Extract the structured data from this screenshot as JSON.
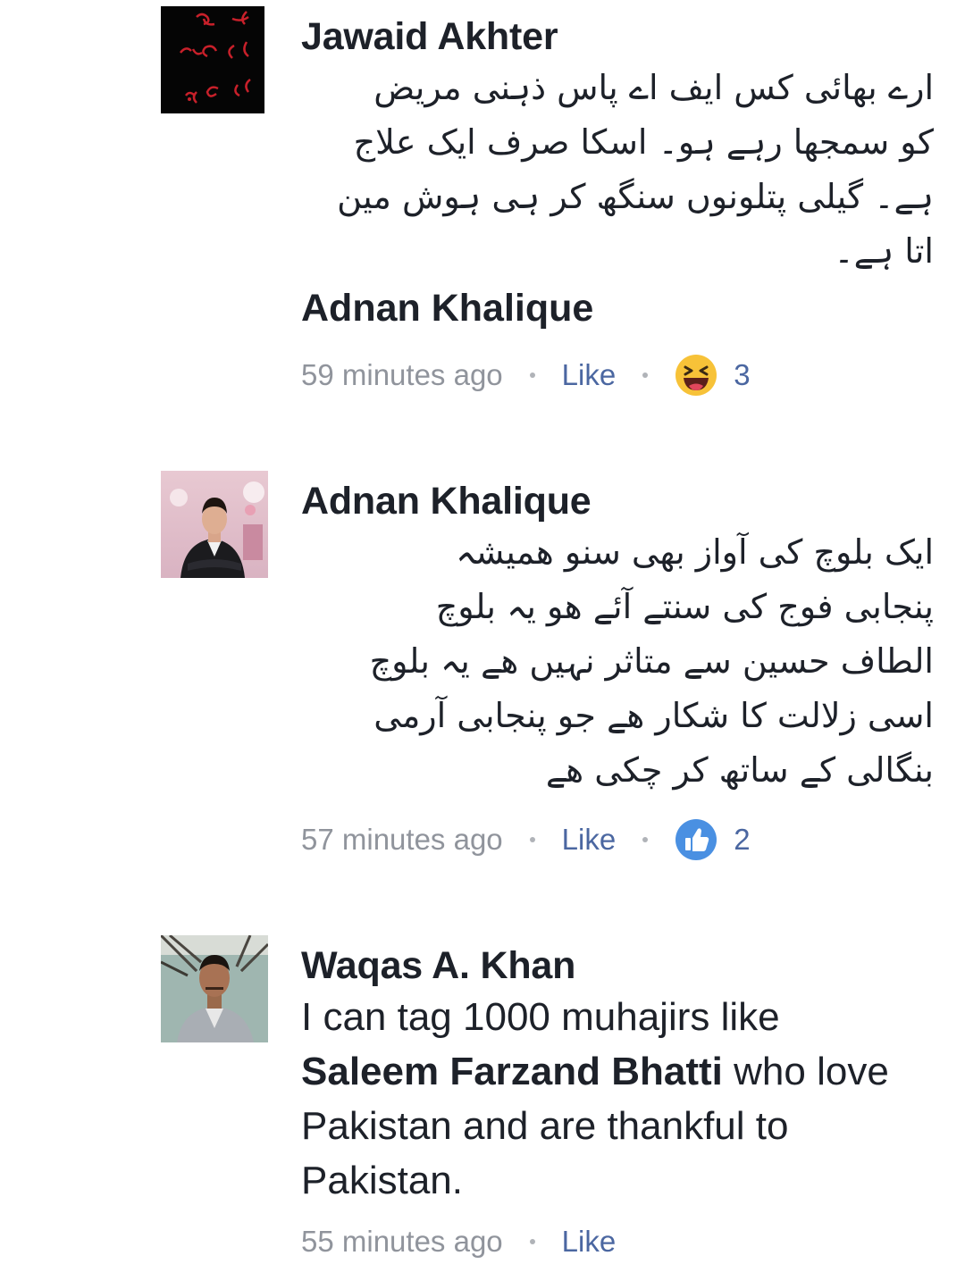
{
  "comments": [
    {
      "author": "Jawaid Akhter",
      "avatar_icon": "red-urdu-calligraphy-avatar",
      "text_lines": [
        "ارے بھائی کس ایف اے پاس ذہنی مریض",
        "کو سمجھا رہے ہو۔ اسکا صرف ایک علاج",
        "ہے۔ گیلی پتلونوں سنگھ کر ہی ہوش مین",
        "اتا ہے۔"
      ],
      "mentioned_reply_to": "Adnan Khalique",
      "time": "59 minutes ago",
      "like_label": "Like",
      "reaction_icon": "haha-emoji-icon",
      "reaction_count": "3"
    },
    {
      "author": "Adnan Khalique",
      "avatar_icon": "man-in-suit-avatar",
      "text_lines": [
        "ایک بلوچ کی آواز بھی سنو ھمیشہ",
        "پنجابی فوج کی سنتے آئے ھو یہ بلوچ",
        "الطاف حسین سے متاثر نہیں ھے یہ بلوچ",
        "اسی زلالت کا شکار ھے جو پنجابی آرمی",
        "بنگالی کے ساتھ کر چکی ھے"
      ],
      "time": "57 minutes ago",
      "like_label": "Like",
      "reaction_icon": "thumbs-up-icon",
      "reaction_count": "2"
    },
    {
      "author": "Waqas A. Khan",
      "avatar_icon": "man-portrait-avatar",
      "text_before": "I can tag 1000 muhajirs like",
      "mention": "Saleem Farzand Bhatti",
      "text_after": " who love Pakistan and are thankful to Pakistan.",
      "time": "55 minutes ago",
      "like_label": "Like"
    }
  ],
  "colors": {
    "text": "#1d2129",
    "meta": "#90949c",
    "link": "#4b67a1",
    "like_blue": "#4a90e2",
    "haha_yellow": "#f7c238"
  }
}
